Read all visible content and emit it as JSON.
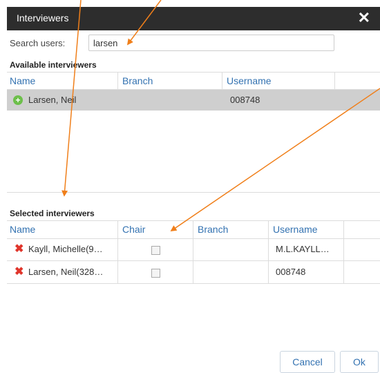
{
  "dialog": {
    "title": "Interviewers",
    "close_icon": "close-icon"
  },
  "search": {
    "label": "Search users:",
    "value": "larsen"
  },
  "available": {
    "title": "Available interviewers",
    "columns": [
      "Name",
      "Branch",
      "Username"
    ],
    "rows": [
      {
        "name": "Larsen, Neil",
        "branch": "",
        "username": "008748",
        "icon": "add-circle-icon"
      }
    ]
  },
  "selected": {
    "title": "Selected interviewers",
    "columns": [
      "Name",
      "Chair",
      "Branch",
      "Username"
    ],
    "rows": [
      {
        "name": "Kayll, Michelle(9…",
        "chair": false,
        "branch": "",
        "username": "M.L.KAYLL…",
        "icon": "remove-x-icon"
      },
      {
        "name": "Larsen, Neil(328…",
        "chair": false,
        "branch": "",
        "username": "008748",
        "icon": "remove-x-icon"
      }
    ]
  },
  "buttons": {
    "cancel": "Cancel",
    "ok": "Ok"
  },
  "colors": {
    "titlebar": "#2d2d2d",
    "accent": "#3372b1",
    "arrow": "#f07f1a",
    "selected_row": "#cfcfcf"
  }
}
